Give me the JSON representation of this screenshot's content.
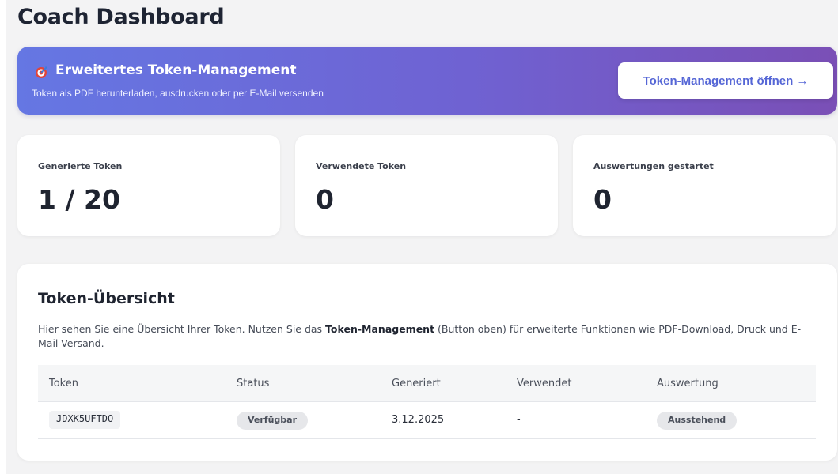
{
  "header": {
    "title": "Coach Dashboard"
  },
  "banner": {
    "icon": "target-icon",
    "title": "Erweitertes Token-Management",
    "subtitle": "Token als PDF herunterladen, ausdrucken oder per E-Mail versenden",
    "button_label": "Token-Management öffnen →"
  },
  "stats": [
    {
      "label": "Generierte Token",
      "value": "1 / 20"
    },
    {
      "label": "Verwendete Token",
      "value": "0"
    },
    {
      "label": "Auswertungen gestartet",
      "value": "0"
    }
  ],
  "overview": {
    "title": "Token-Übersicht",
    "desc_before": "Hier sehen Sie eine Übersicht Ihrer Token. Nutzen Sie das ",
    "desc_bold": "Token-Management",
    "desc_after": " (Button oben) für erweiterte Funktionen wie PDF-Download, Druck und E-Mail-Versand.",
    "columns": [
      "Token",
      "Status",
      "Generiert",
      "Verwendet",
      "Auswertung"
    ],
    "rows": [
      {
        "token": "JDXK5UFTDO",
        "status": "Verfügbar",
        "generated": "3.12.2025",
        "used": "-",
        "evaluation": "Ausstehend"
      }
    ]
  },
  "colors": {
    "accent": "#5566d6",
    "banner_start": "#6577e3",
    "banner_end": "#7a4fb6",
    "icon_red": "#e0453a"
  }
}
